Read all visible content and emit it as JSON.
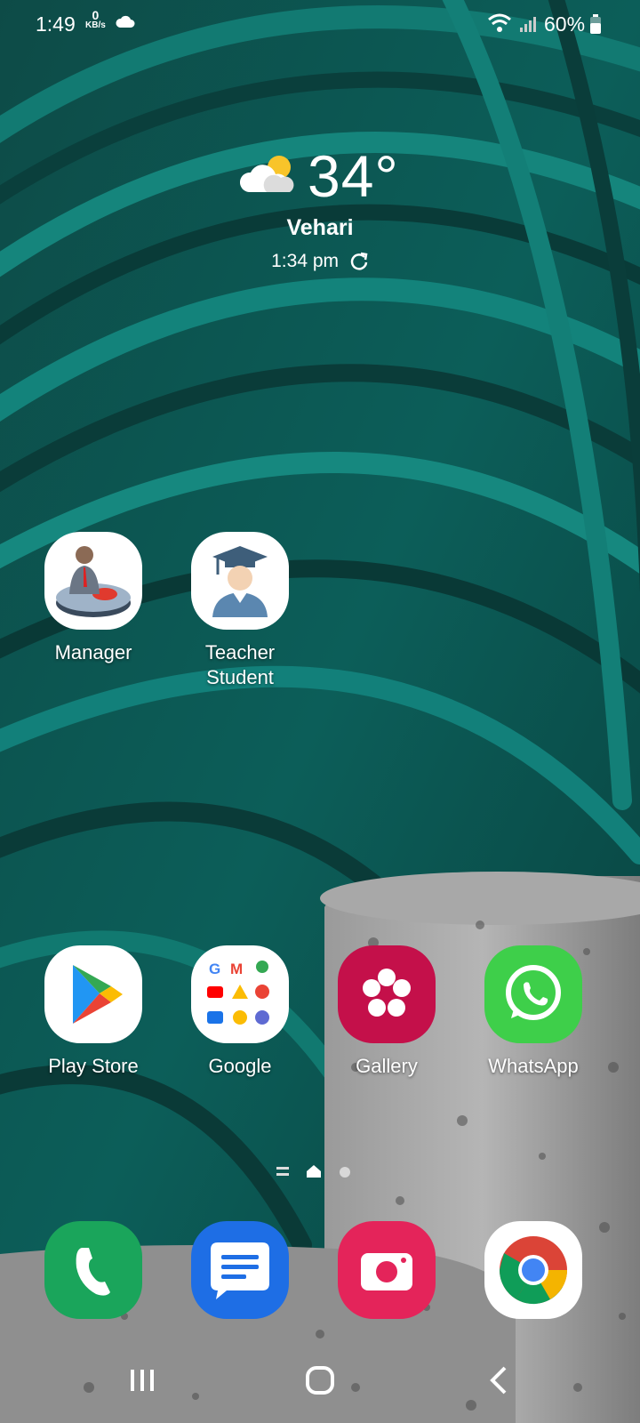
{
  "status_bar": {
    "time": "1:49",
    "net_speed_value": "0",
    "net_speed_unit": "KB/s",
    "battery": "60%",
    "icons": [
      "cloud-icon",
      "wifi-icon",
      "signal-icon",
      "battery-icon"
    ]
  },
  "weather": {
    "temperature": "34°",
    "location": "Vehari",
    "updated": "1:34 pm",
    "icon": "partly-sunny-icon"
  },
  "apps_top": [
    {
      "label": "Manager"
    },
    {
      "label_line1": "Teacher",
      "label_line2": "Student"
    }
  ],
  "apps_row": [
    {
      "label": "Play Store"
    },
    {
      "label": "Google"
    },
    {
      "label": "Gallery"
    },
    {
      "label": "WhatsApp"
    }
  ],
  "dock": [
    {
      "icon": "phone-icon"
    },
    {
      "icon": "messages-icon"
    },
    {
      "icon": "camera-icon"
    },
    {
      "icon": "chrome-icon"
    }
  ],
  "page_indicator": {
    "pages": 2,
    "current": "home"
  },
  "nav_bar": {
    "items": [
      "recents-button",
      "home-button",
      "back-button"
    ]
  },
  "colors": {
    "wallpaper_teal": "#0c5f5a",
    "stone": "#8a8a8a"
  }
}
